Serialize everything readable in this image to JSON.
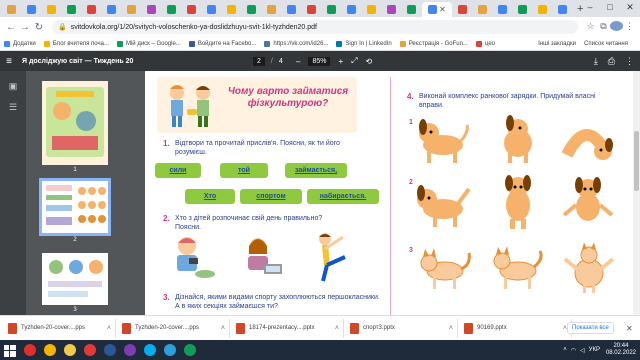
{
  "browser": {
    "url": "svitdovkola.org/1/20/svitych-voloschenko-ya-doslidzhuyu-svit-1kl-tyzhden20.pdf",
    "tab_icon_colors": [
      "#e6a23c",
      "#4285f4",
      "#f4b400",
      "#0f9d58",
      "#db4437",
      "#4285f4",
      "#e6a23c",
      "#ab47bc",
      "#0f9d58",
      "#db4437",
      "#4285f4",
      "#f4b400",
      "#0f9d58",
      "#e6a23c",
      "#4285f4",
      "#db4437",
      "#0f9d58",
      "#4285f4",
      "#f4b400",
      "#ab47bc",
      "#0f9d58",
      "#4285f4",
      "#db4437",
      "#e6a23c",
      "#4285f4",
      "#0f9d58",
      "#f4b400",
      "#4285f4"
    ],
    "bookmarks": [
      {
        "label": "Додатки",
        "color": "#4285f4"
      },
      {
        "label": "Блог вчителя поча...",
        "color": "#f4b400"
      },
      {
        "label": "Мій диск – Google...",
        "color": "#0f9d58"
      },
      {
        "label": "Войдите на Facebo...",
        "color": "#3b5998"
      },
      {
        "label": "https://vk.com/id26...",
        "color": "#4c75a3"
      },
      {
        "label": "Sign In | LinkedIn",
        "color": "#0077b5"
      },
      {
        "label": "Реєстрація - GoFun...",
        "color": "#e6a23c"
      },
      {
        "label": "цео",
        "color": "#db4437"
      }
    ],
    "bookmarks_right": [
      "Інші закладки",
      "Список читання"
    ]
  },
  "pdf": {
    "title": "Я досліджую світ — Тиждень 20",
    "page_current": "2",
    "page_total": "4",
    "zoom": "85%",
    "thumb_numbers": [
      "1",
      "2",
      "3"
    ]
  },
  "content": {
    "heading": "Чому варто займатися фізкультурою?",
    "q1_num": "1.",
    "q1_text": "Відтвори та прочитай прислів'я. Поясни, як ти його розумієш.",
    "puzzle_words": [
      "сили",
      "той",
      "займається,",
      "Хто",
      "спортом",
      "набирається."
    ],
    "q2_num": "2.",
    "q2_text": "Хто з дітей розпочинає свій день правильно? Поясни.",
    "q3_num": "3.",
    "q3_text": "Дізнайся, якими видами спорту захоплюються першокласники. А в яких секціях займаєшся ти?",
    "q4_num": "4.",
    "q4_text": "Виконай комплекс ранкової зарядки. Придумай власні вправи.",
    "row_markers": [
      "1",
      "2",
      "3"
    ]
  },
  "downloads": {
    "items": [
      {
        "name": "Tyzhden-20-cover....pps",
        "color": "#d24726"
      },
      {
        "name": "Tyzhden-20-cover....pps",
        "color": "#d24726"
      },
      {
        "name": "18174-prezentacy....pptx",
        "color": "#d24726"
      },
      {
        "name": "спорт3.pptx",
        "color": "#d24726"
      },
      {
        "name": "90169.pptx",
        "color": "#d24726"
      }
    ],
    "show_all": "Показати все"
  },
  "taskbar": {
    "icons": [
      {
        "name": "start-icon",
        "color": "#1f2a3a"
      },
      {
        "name": "opera-icon",
        "color": "#e0302b"
      },
      {
        "name": "chrome-icon",
        "color": "#f4b400"
      },
      {
        "name": "explorer-icon",
        "color": "#f2c94c"
      },
      {
        "name": "yandex-icon",
        "color": "#e53935"
      },
      {
        "name": "word-icon",
        "color": "#2b5797"
      },
      {
        "name": "viber-icon",
        "color": "#7d3daf"
      },
      {
        "name": "skype-icon",
        "color": "#00aff0"
      },
      {
        "name": "telegram-icon",
        "color": "#2aa1da"
      },
      {
        "name": "chrome2-icon",
        "color": "#0f9d58"
      }
    ],
    "lang": "УКР",
    "time": "20:44",
    "date": "08.02.2022"
  }
}
